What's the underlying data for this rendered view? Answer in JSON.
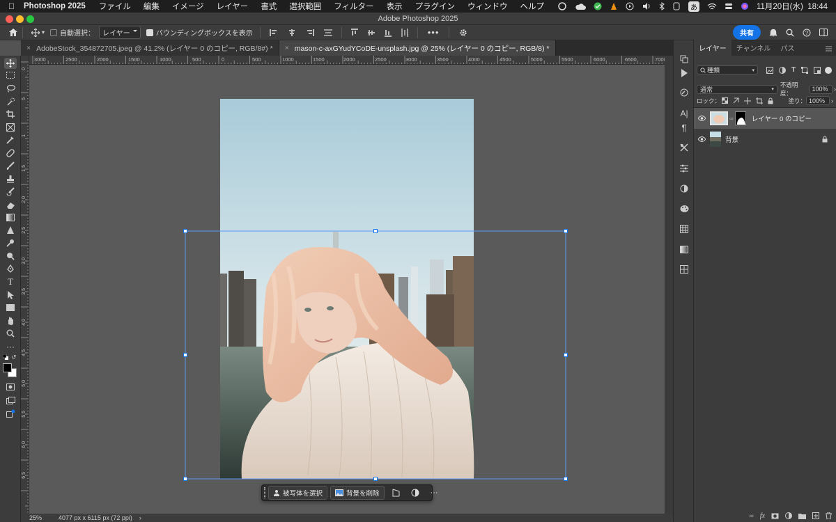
{
  "menubar": {
    "app_name": "Photoshop 2025",
    "items": [
      "ファイル",
      "編集",
      "イメージ",
      "レイヤー",
      "書式",
      "選択範囲",
      "フィルター",
      "表示",
      "プラグイン",
      "ウィンドウ",
      "ヘルプ"
    ],
    "input_mode": "あ",
    "clock": "11月20日(水)  18:44"
  },
  "window": {
    "title": "Adobe Photoshop 2025"
  },
  "options": {
    "auto_select_label": "自動選択：",
    "auto_select_target": "レイヤー",
    "bounding_box_label": "バウンディングボックスを表示",
    "share_label": "共有"
  },
  "tabs": [
    {
      "label": "AdobeStock_354872705.jpeg @ 41.2% (レイヤー 0 のコピー, RGB/8#) *",
      "active": false
    },
    {
      "label": "mason-c-axGYudYCoDE-unsplash.jpg @ 25% (レイヤー 0 のコピー, RGB/8) *",
      "active": true
    }
  ],
  "ruler": {
    "top": [
      "3000",
      "2500",
      "2000",
      "1500",
      "1000",
      "500",
      "0",
      "500",
      "1000",
      "1500",
      "2000",
      "2500",
      "3000",
      "3500",
      "4000",
      "4500",
      "5000",
      "5500",
      "6000",
      "6500",
      "7000"
    ],
    "left": [
      "0",
      "5",
      "1",
      "1\n5",
      "2\n0",
      "2\n5",
      "3\n0",
      "3\n5",
      "4\n0",
      "4\n5",
      "5\n0",
      "5\n5",
      "6\n0",
      "6\n5"
    ]
  },
  "status": {
    "zoom": "25%",
    "doc_info": "4077 px x 6115 px (72 ppi)"
  },
  "context_bar": {
    "select_subject": "被写体を選択",
    "remove_background": "背景を削除"
  },
  "panel": {
    "tabs": [
      "レイヤー",
      "チャンネル",
      "パス"
    ],
    "filter_kind": "種類",
    "blend_mode": "通常",
    "opacity_label": "不透明度：",
    "opacity_value": "100%",
    "lock_label": "ロック：",
    "fill_label": "塗り：",
    "fill_value": "100%",
    "layers": [
      {
        "name": "レイヤー 0 のコピー",
        "active": true
      },
      {
        "name": "背景",
        "active": false
      }
    ]
  },
  "colors": {
    "accent": "#1473e6",
    "panel_bg": "#3c3c3c",
    "canvas_bg": "#5a5a5a"
  }
}
